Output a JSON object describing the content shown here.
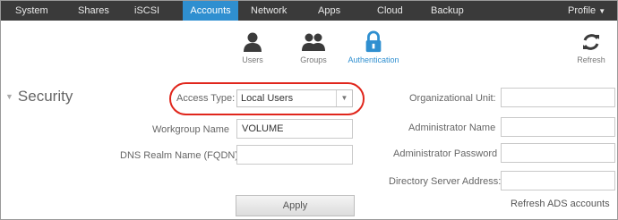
{
  "topnav": {
    "items": [
      {
        "label": "System"
      },
      {
        "label": "Shares"
      },
      {
        "label": "iSCSI"
      },
      {
        "label": "Accounts",
        "active": true
      },
      {
        "label": "Network"
      },
      {
        "label": "Apps"
      },
      {
        "label": "Cloud"
      },
      {
        "label": "Backup"
      }
    ],
    "profile_label": "Profile",
    "active_color": "#2f8fd0"
  },
  "subtoolbar": {
    "users_label": "Users",
    "groups_label": "Groups",
    "authentication_label": "Authentication",
    "refresh_label": "Refresh"
  },
  "security": {
    "title": "Security",
    "access_type_label": "Access Type:",
    "access_type_value": "Local Users",
    "workgroup_label": "Workgroup Name",
    "workgroup_value": "VOLUME",
    "dns_label": "DNS Realm Name (FQDN)",
    "dns_value": "",
    "org_unit_label": "Organizational Unit:",
    "admin_name_label": "Administrator Name",
    "admin_password_label": "Administrator Password",
    "directory_server_label": "Directory Server Address:",
    "apply_label": "Apply",
    "refresh_ads_label": "Refresh ADS accounts",
    "highlight_color": "#e0261c"
  }
}
